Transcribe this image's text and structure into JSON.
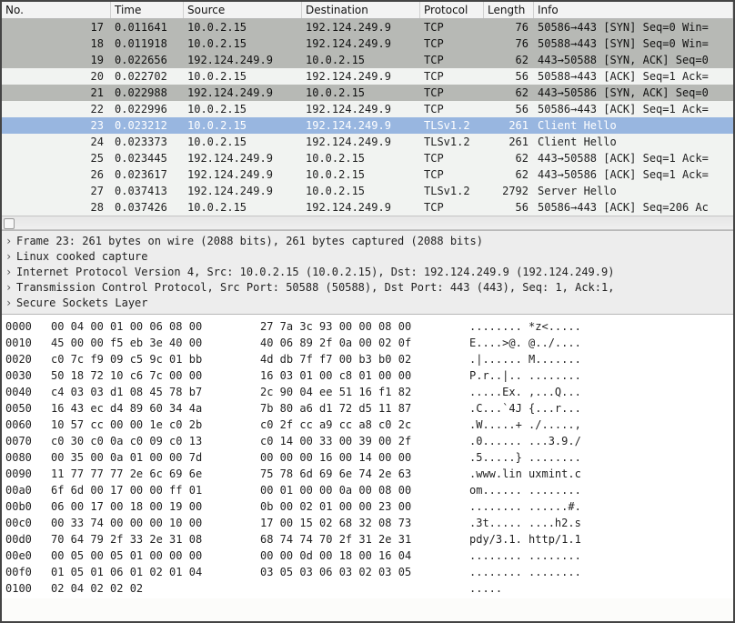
{
  "columns": {
    "no": "No.",
    "time": "Time",
    "source": "Source",
    "destination": "Destination",
    "protocol": "Protocol",
    "length": "Length",
    "info": "Info"
  },
  "packets": [
    {
      "no": "17",
      "time": "0.011641",
      "source": "10.0.2.15",
      "destination": "192.124.249.9",
      "protocol": "TCP",
      "length": "76",
      "info": "50586→443 [SYN] Seq=0 Win=",
      "cls": "row-dark"
    },
    {
      "no": "18",
      "time": "0.011918",
      "source": "10.0.2.15",
      "destination": "192.124.249.9",
      "protocol": "TCP",
      "length": "76",
      "info": "50588→443 [SYN] Seq=0 Win=",
      "cls": "row-dark"
    },
    {
      "no": "19",
      "time": "0.022656",
      "source": "192.124.249.9",
      "destination": "10.0.2.15",
      "protocol": "TCP",
      "length": "62",
      "info": "443→50588 [SYN, ACK] Seq=0",
      "cls": "row-dark"
    },
    {
      "no": "20",
      "time": "0.022702",
      "source": "10.0.2.15",
      "destination": "192.124.249.9",
      "protocol": "TCP",
      "length": "56",
      "info": "50588→443 [ACK] Seq=1 Ack=",
      "cls": "row-light"
    },
    {
      "no": "21",
      "time": "0.022988",
      "source": "192.124.249.9",
      "destination": "10.0.2.15",
      "protocol": "TCP",
      "length": "62",
      "info": "443→50586 [SYN, ACK] Seq=0",
      "cls": "row-dark"
    },
    {
      "no": "22",
      "time": "0.022996",
      "source": "10.0.2.15",
      "destination": "192.124.249.9",
      "protocol": "TCP",
      "length": "56",
      "info": "50586→443 [ACK] Seq=1 Ack=",
      "cls": "row-light"
    },
    {
      "no": "23",
      "time": "0.023212",
      "source": "10.0.2.15",
      "destination": "192.124.249.9",
      "protocol": "TLSv1.2",
      "length": "261",
      "info": "Client Hello",
      "cls": "row-sel"
    },
    {
      "no": "24",
      "time": "0.023373",
      "source": "10.0.2.15",
      "destination": "192.124.249.9",
      "protocol": "TLSv1.2",
      "length": "261",
      "info": "Client Hello",
      "cls": "row-light"
    },
    {
      "no": "25",
      "time": "0.023445",
      "source": "192.124.249.9",
      "destination": "10.0.2.15",
      "protocol": "TCP",
      "length": "62",
      "info": "443→50588 [ACK] Seq=1 Ack=",
      "cls": "row-light"
    },
    {
      "no": "26",
      "time": "0.023617",
      "source": "192.124.249.9",
      "destination": "10.0.2.15",
      "protocol": "TCP",
      "length": "62",
      "info": "443→50586 [ACK] Seq=1 Ack=",
      "cls": "row-light"
    },
    {
      "no": "27",
      "time": "0.037413",
      "source": "192.124.249.9",
      "destination": "10.0.2.15",
      "protocol": "TLSv1.2",
      "length": "2792",
      "info": "Server Hello",
      "cls": "row-light"
    },
    {
      "no": "28",
      "time": "0.037426",
      "source": "10.0.2.15",
      "destination": "192.124.249.9",
      "protocol": "TCP",
      "length": "56",
      "info": "50586→443 [ACK] Seq=206 Ac",
      "cls": "row-light"
    }
  ],
  "details": [
    "Frame 23: 261 bytes on wire (2088 bits), 261 bytes captured (2088 bits)",
    "Linux cooked capture",
    "Internet Protocol Version 4, Src: 10.0.2.15 (10.0.2.15), Dst: 192.124.249.9 (192.124.249.9)",
    "Transmission Control Protocol, Src Port: 50588 (50588), Dst Port: 443 (443), Seq: 1, Ack:1,",
    "Secure Sockets Layer"
  ],
  "chevron": "›",
  "hex": [
    {
      "off": "0000",
      "a": "00 04 00 01 00 06 08 00",
      "b": "27 7a 3c 93 00 00 08 00",
      "t": "........ *z<....."
    },
    {
      "off": "0010",
      "a": "45 00 00 f5 eb 3e 40 00",
      "b": "40 06 89 2f 0a 00 02 0f",
      "t": "E....>@. @../...."
    },
    {
      "off": "0020",
      "a": "c0 7c f9 09 c5 9c 01 bb",
      "b": "4d db 7f f7 00 b3 b0 02",
      "t": ".|...... M......."
    },
    {
      "off": "0030",
      "a": "50 18 72 10 c6 7c 00 00",
      "b": "16 03 01 00 c8 01 00 00",
      "t": "P.r..|.. ........"
    },
    {
      "off": "0040",
      "a": "c4 03 03 d1 08 45 78 b7",
      "b": "2c 90 04 ee 51 16 f1 82",
      "t": ".....Ex. ,...Q..."
    },
    {
      "off": "0050",
      "a": "16 43 ec d4 89 60 34 4a",
      "b": "7b 80 a6 d1 72 d5 11 87",
      "t": ".C...`4J {...r..."
    },
    {
      "off": "0060",
      "a": "10 57 cc 00 00 1e c0 2b",
      "b": "c0 2f cc a9 cc a8 c0 2c",
      "t": ".W.....+ ./.....,"
    },
    {
      "off": "0070",
      "a": "c0 30 c0 0a c0 09 c0 13",
      "b": "c0 14 00 33 00 39 00 2f",
      "t": ".0...... ...3.9./"
    },
    {
      "off": "0080",
      "a": "00 35 00 0a 01 00 00 7d",
      "b": "00 00 00 16 00 14 00 00",
      "t": ".5.....} ........"
    },
    {
      "off": "0090",
      "a": "11 77 77 77 2e 6c 69 6e",
      "b": "75 78 6d 69 6e 74 2e 63",
      "t": ".www.lin uxmint.c"
    },
    {
      "off": "00a0",
      "a": "6f 6d 00 17 00 00 ff 01",
      "b": "00 01 00 00 0a 00 08 00",
      "t": "om...... ........"
    },
    {
      "off": "00b0",
      "a": "06 00 17 00 18 00 19 00",
      "b": "0b 00 02 01 00 00 23 00",
      "t": "........ ......#."
    },
    {
      "off": "00c0",
      "a": "00 33 74 00 00 00 10 00",
      "b": "17 00 15 02 68 32 08 73",
      "t": ".3t..... ....h2.s"
    },
    {
      "off": "00d0",
      "a": "70 64 79 2f 33 2e 31 08",
      "b": "68 74 74 70 2f 31 2e 31",
      "t": "pdy/3.1. http/1.1"
    },
    {
      "off": "00e0",
      "a": "00 05 00 05 01 00 00 00",
      "b": "00 00 0d 00 18 00 16 04",
      "t": "........ ........"
    },
    {
      "off": "00f0",
      "a": "01 05 01 06 01 02 01 04",
      "b": "03 05 03 06 03 02 03 05",
      "t": "........ ........"
    },
    {
      "off": "0100",
      "a": "02 04 02 02 02",
      "b": "",
      "t": "....."
    }
  ]
}
